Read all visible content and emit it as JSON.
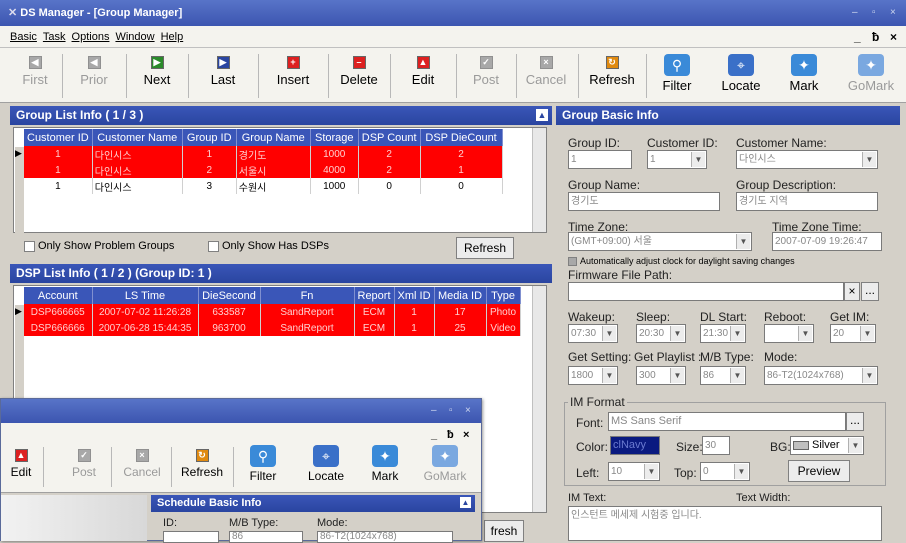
{
  "window": {
    "title": "DS Manager - [Group Manager]",
    "icon": "app-icon",
    "controls": [
      "–",
      "▫",
      "×"
    ]
  },
  "menu": {
    "items": [
      "Basic",
      "Task",
      "Options",
      "Window",
      "Help"
    ],
    "mdi_controls": [
      "_",
      "ƀ",
      "×"
    ]
  },
  "toolbar": {
    "first": "First",
    "prior": "Prior",
    "next": "Next",
    "last": "Last",
    "insert": "Insert",
    "delete": "Delete",
    "edit": "Edit",
    "post": "Post",
    "cancel": "Cancel",
    "refresh": "Refresh",
    "filter": "Filter",
    "locate": "Locate",
    "mark": "Mark",
    "gomark": "GoMark"
  },
  "group_list": {
    "title": "Group List Info ( 1 / 3 )",
    "columns": [
      "Customer ID",
      "Customer Name",
      "Group ID",
      "Group Name",
      "Storage",
      "DSP Count",
      "DSP DieCount"
    ],
    "rows": [
      [
        "1",
        "다인시스",
        "1",
        "경기도",
        "1000",
        "2",
        "2"
      ],
      [
        "1",
        "다인시스",
        "2",
        "서울시",
        "4000",
        "2",
        "1"
      ],
      [
        "1",
        "다인시스",
        "3",
        "수원시",
        "1000",
        "0",
        "0"
      ]
    ],
    "only_problem": "Only Show Problem Groups",
    "only_has_dsps": "Only Show Has DSPs",
    "refresh": "Refresh"
  },
  "dsp_list": {
    "title": "DSP List Info ( 1 / 2 ) (Group ID: 1 )",
    "columns": [
      "Account",
      "LS Time",
      "DieSecond",
      "Fn",
      "Report",
      "Xml ID",
      "Media ID",
      "Type"
    ],
    "rows": [
      [
        "DSP666665",
        "2007-07-02 11:26:28",
        "633587",
        "SandReport",
        "ECM",
        "1",
        "17",
        "Photo"
      ],
      [
        "DSP666666",
        "2007-06-28 15:44:35",
        "963700",
        "SandReport",
        "ECM",
        "1",
        "25",
        "Video"
      ]
    ],
    "refresh_partial": "fresh"
  },
  "group_basic": {
    "title": "Group Basic Info",
    "group_id_label": "Group ID:",
    "group_id": "1",
    "customer_id_label": "Customer ID:",
    "customer_id": "1",
    "customer_name_label": "Customer Name:",
    "customer_name": "다인시스",
    "group_name_label": "Group Name:",
    "group_name": "경기도",
    "group_desc_label": "Group Description:",
    "group_desc": "경기도 지역",
    "time_zone_label": "Time Zone:",
    "time_zone": "(GMT+09:00) 서울",
    "tz_time_label": "Time Zone Time:",
    "tz_time": "2007-07-09 19:26:47",
    "dst_label": "Automatically adjust clock for daylight saving changes",
    "firmware_label": "Firmware File Path:",
    "firmware": "",
    "clear_btn": "×",
    "browse_btn": "...",
    "wakeup_label": "Wakeup:",
    "wakeup": "07:30",
    "sleep_label": "Sleep:",
    "sleep": "20:30",
    "dl_start_label": "DL Start:",
    "dl_start": "21:30",
    "reboot_label": "Reboot:",
    "reboot": "",
    "get_im_label": "Get IM:",
    "get_im": "20",
    "get_setting_label": "Get Setting:",
    "get_setting": "1800",
    "get_playlist_label": "Get Playlist :",
    "get_playlist": "300",
    "mb_type_label": "M/B Type:",
    "mb_type": "86",
    "mode_label": "Mode:",
    "mode": "86-T2(1024x768)",
    "im_format_label": "IM Format",
    "font_label": "Font:",
    "font": "MS Sans Serif",
    "font_btn": "...",
    "color_label": "Color:",
    "color": "clNavy",
    "size_label": "Size:",
    "size": "30",
    "bg_label": "BG:",
    "bg": "Silver",
    "left_label": "Left:",
    "left": "10",
    "top_label": "Top:",
    "top": "0",
    "preview": "Preview",
    "im_text_label": "IM Text:",
    "text_width_label": "Text Width:",
    "im_text": "인스턴트 메세제 시험중 입니다."
  },
  "overlay": {
    "controls": [
      "–",
      "▫",
      "×"
    ],
    "mdi_controls": [
      "_",
      "ƀ",
      "×"
    ],
    "edit": "Edit",
    "post": "Post",
    "cancel": "Cancel",
    "refresh": "Refresh",
    "filter": "Filter",
    "locate": "Locate",
    "mark": "Mark",
    "gomark": "GoMark",
    "schedule_title": "Schedule Basic Info",
    "id_label": "ID:",
    "mb_type_label": "M/B Type:",
    "mode_label": "Mode:",
    "id": "",
    "mb_type": "86",
    "mode": "86-T2(1024x768)"
  },
  "colors": {
    "accent": "#2a45a0",
    "alert_row": "#ff0000"
  }
}
